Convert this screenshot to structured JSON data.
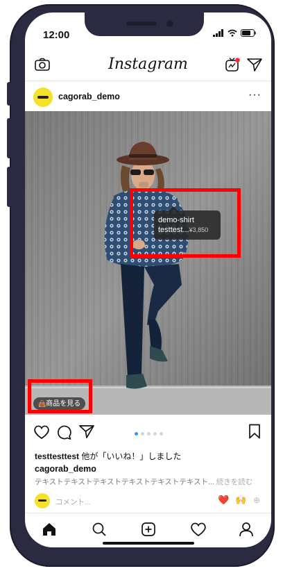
{
  "status": {
    "time": "12:00"
  },
  "app": {
    "logo": "Instagram"
  },
  "post": {
    "username": "cagorab_demo",
    "more_label": "···",
    "product_tag": {
      "name": "demo-shirt",
      "desc": "testtest...",
      "price": "¥3,850"
    },
    "shop_button": "商品を見る",
    "carousel": {
      "count": 5,
      "active_index": 0
    },
    "likes": {
      "user": "testtesttest",
      "text": " 他が「いいね！」しました"
    },
    "caption": {
      "user": "cagorab_demo",
      "text": "テキストテキストテキストテキストテキストテキスト...",
      "more": "続きを読む"
    },
    "comment_placeholder": "コメント...",
    "quick_emojis": [
      "❤️",
      "🙌",
      "⊕"
    ]
  },
  "icons": {
    "top_left": "camera-icon",
    "top_right": [
      "igtv-icon",
      "direct-message-icon"
    ],
    "actions": [
      "heart-icon",
      "comment-icon",
      "share-icon",
      "bookmark-icon"
    ],
    "bottom_nav": [
      "home-icon",
      "search-icon",
      "add-post-icon",
      "activity-icon",
      "profile-icon"
    ]
  },
  "colors": {
    "highlight": "#ff0000",
    "dot_active": "#3897f0",
    "avatar": "#f5e02a",
    "frame": "#2a2a40"
  }
}
